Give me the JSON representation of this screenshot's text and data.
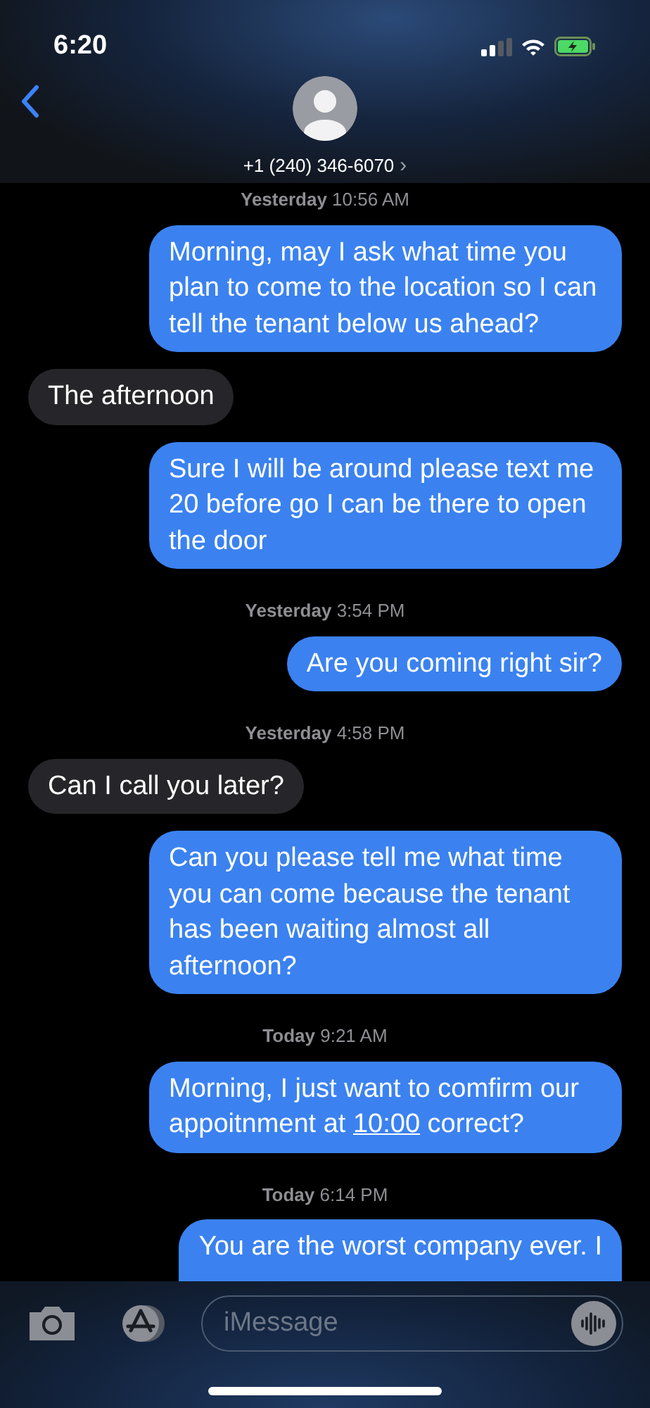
{
  "status_bar": {
    "time": "6:20"
  },
  "header": {
    "contact": "+1 (240) 346-6070",
    "chevron": "›"
  },
  "messages": [
    {
      "kind": "time",
      "text": "**Yesterday** 10:56 AM"
    },
    {
      "kind": "sent",
      "parts": [
        {
          "kind": "text",
          "text": "Morning, may I ask what time you plan to come to the location so I can tell the tenant below us ahead?"
        }
      ]
    },
    {
      "kind": "received",
      "parts": [
        {
          "kind": "text",
          "text": "The afternoon"
        }
      ]
    },
    {
      "kind": "sent",
      "parts": [
        {
          "kind": "text",
          "text": "Sure I will be around please text me 20 before go I can be there to open the door"
        }
      ]
    },
    {
      "kind": "time",
      "text": "**Yesterday** 3:54 PM"
    },
    {
      "kind": "sent",
      "parts": [
        {
          "kind": "text",
          "text": "Are you coming right sir?"
        }
      ]
    },
    {
      "kind": "time",
      "text": "**Yesterday** 4:58 PM"
    },
    {
      "kind": "received",
      "parts": [
        {
          "kind": "text",
          "text": "Can I call you later?"
        }
      ]
    },
    {
      "kind": "sent",
      "parts": [
        {
          "kind": "text",
          "text": "Can you please tell me what time you can come because the tenant has been waiting almost all afternoon?"
        }
      ]
    },
    {
      "kind": "time",
      "text": "**Today** 9:21 AM"
    },
    {
      "kind": "sent",
      "parts": [
        {
          "kind": "text",
          "text": "Morning, I just want to comfirm our appoitnment at "
        },
        {
          "kind": "link",
          "text": "10:00"
        },
        {
          "kind": "text",
          "text": " correct?"
        }
      ]
    },
    {
      "kind": "time",
      "text": "**Today** 6:14 PM"
    },
    {
      "kind": "sent",
      "parts": [
        {
          "kind": "text",
          "text": "You are the worst company ever. I"
        }
      ]
    }
  ],
  "composer": {
    "placeholder": "iMessage"
  }
}
